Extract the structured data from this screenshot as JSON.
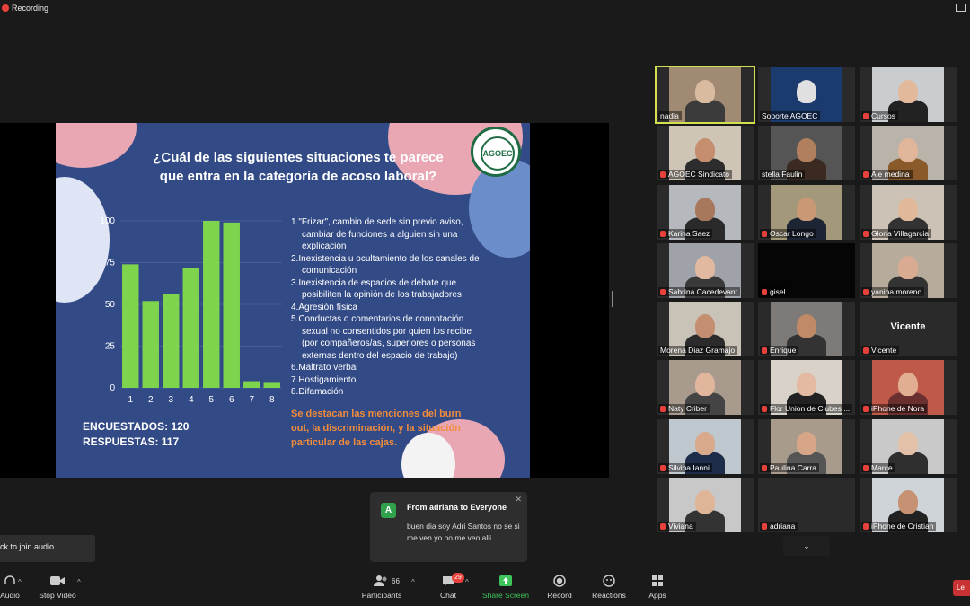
{
  "recording": {
    "label": "Recording"
  },
  "slide": {
    "title_line1": "¿Cuál de las siguientes situaciones te parece",
    "title_line2": "que entra en la categoría de acoso laboral?",
    "logo_text": "AGOEC",
    "list": [
      [
        "1.\"Frizar\", cambio de sede sin previo aviso,",
        "cambiar de funciones a alguien sin una",
        "explicación"
      ],
      [
        "2.Inexistencia u ocultamiento de los canales de",
        "comunicación"
      ],
      [
        "3.Inexistencia de espacios de debate que",
        "posibiliten la opinión de los trabajadores"
      ],
      [
        "4.Agresión física"
      ],
      [
        "5.Conductas o comentarios de connotación",
        "sexual no consentidos por quien los recibe",
        "(por compañeros/as, superiores o personas",
        "externas dentro del espacio de trabajo)"
      ],
      [
        "6.Maltrato verbal"
      ],
      [
        "7.Hostigamiento"
      ],
      [
        "8.Difamación"
      ]
    ],
    "note_line1": "Se destacan las menciones del burn",
    "note_line2": "out, la discriminación, y la situación",
    "note_line3": "particular de las cajas.",
    "encuestados": "ENCUESTADOS: 120",
    "respuestas": "RESPUESTAS: 117"
  },
  "chart_data": {
    "type": "bar",
    "categories": [
      "1",
      "2",
      "3",
      "4",
      "5",
      "6",
      "7",
      "8"
    ],
    "values": [
      74,
      52,
      56,
      72,
      100,
      99,
      4,
      3
    ],
    "yticks": [
      "100",
      "75",
      "50",
      "25",
      "0"
    ],
    "ylim": [
      0,
      100
    ],
    "bar_color": "#7fd44e",
    "grid": true
  },
  "participants": [
    {
      "name": "nadia",
      "muted": false,
      "active": true
    },
    {
      "name": "Soporte AGOEC",
      "muted": false
    },
    {
      "name": "Cursos",
      "muted": true
    },
    {
      "name": "AGOEC Sindicato",
      "muted": true
    },
    {
      "name": "stella Faulin",
      "muted": false
    },
    {
      "name": "Ale medina",
      "muted": true
    },
    {
      "name": "Karina Saez",
      "muted": true
    },
    {
      "name": "Oscar Longo",
      "muted": true
    },
    {
      "name": "Gloria Villagarcia",
      "muted": true
    },
    {
      "name": "Sabrina Cacedevant",
      "muted": true
    },
    {
      "name": "gisel",
      "muted": true
    },
    {
      "name": "yanina moreno",
      "muted": true
    },
    {
      "name": "Morena Diaz Gramajo",
      "muted": false
    },
    {
      "name": "Enrique",
      "muted": true
    },
    {
      "name": "Vicente",
      "muted": true,
      "big_name": "Vicente"
    },
    {
      "name": "Naty Criber",
      "muted": true
    },
    {
      "name": "Flor Union de Clubes ...",
      "muted": true
    },
    {
      "name": "iPhone de Nora",
      "muted": true
    },
    {
      "name": "Silvina Ianni",
      "muted": true
    },
    {
      "name": "Paulina Carra",
      "muted": true
    },
    {
      "name": "Marce",
      "muted": true
    },
    {
      "name": "Viviana",
      "muted": true
    },
    {
      "name": "adriana",
      "muted": true
    },
    {
      "name": "iPhone de Cristian",
      "muted": true
    }
  ],
  "chat_popup": {
    "avatar": "A",
    "from": "From adriana to Everyone",
    "message": "buen dia soy Adri Santos no se si me ven yo no me veo alli"
  },
  "audio_tip": "ck to join audio",
  "toolbar": {
    "audio": "Audio",
    "stop_video": "Stop Video",
    "participants": "Participants",
    "participants_count": "66",
    "chat": "Chat",
    "chat_badge": "29",
    "share_screen": "Share Screen",
    "record": "Record",
    "reactions": "Reactions",
    "apps": "Apps",
    "leave": "Le"
  }
}
